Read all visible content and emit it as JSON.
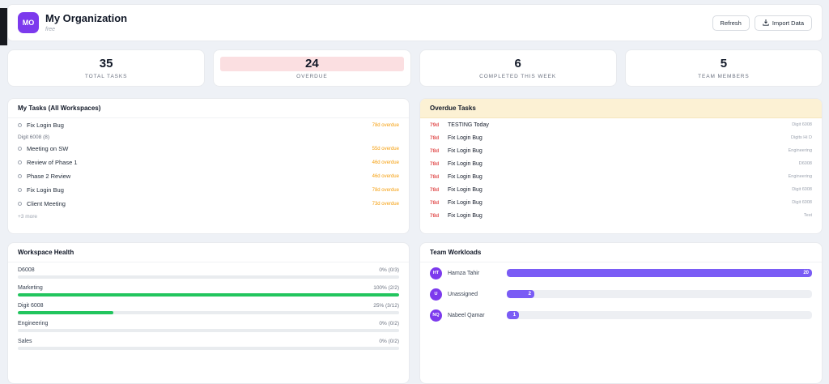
{
  "colors": {
    "accent": "#7c3aed",
    "workload_bar": "#7a5cf5",
    "overdue_stat_bg": "#fbdfe1",
    "overdue_days_text": "#e25555",
    "task_overdue_text": "#f59e0b",
    "health_bar": "#22c55e",
    "overdue_header_bg": "#fcf1d4"
  },
  "header": {
    "avatar_initials": "MO",
    "title": "My Organization",
    "subtitle": "free",
    "refresh_button": "Refresh",
    "import_button": "Import Data"
  },
  "stats": [
    {
      "value": "35",
      "label": "TOTAL TASKS",
      "highlight": false
    },
    {
      "value": "24",
      "label": "OVERDUE",
      "highlight": true
    },
    {
      "value": "6",
      "label": "COMPLETED THIS WEEK",
      "highlight": false
    },
    {
      "value": "5",
      "label": "TEAM MEMBERS",
      "highlight": false
    }
  ],
  "my_tasks": {
    "title": "My Tasks (All Workspaces)",
    "items": [
      {
        "type": "task",
        "name": "Fix Login Bug",
        "overdue": "78d overdue"
      },
      {
        "type": "group",
        "name": "Digit 6008 (8)"
      },
      {
        "type": "task",
        "name": "Meeting on SW",
        "overdue": "55d overdue"
      },
      {
        "type": "task",
        "name": "Review of Phase 1",
        "overdue": "46d overdue"
      },
      {
        "type": "task",
        "name": "Phase 2 Review",
        "overdue": "46d overdue"
      },
      {
        "type": "task",
        "name": "Fix Login Bug",
        "overdue": "78d overdue"
      },
      {
        "type": "task",
        "name": "Client Meeting",
        "overdue": "73d overdue"
      }
    ],
    "more_label": "+3 more"
  },
  "overdue_tasks": {
    "title": "Overdue Tasks",
    "items": [
      {
        "days": "79d",
        "name": "TESTING Today",
        "workspace": "Digit 6008"
      },
      {
        "days": "78d",
        "name": "Fix Login Bug",
        "workspace": "Digits Hi D"
      },
      {
        "days": "78d",
        "name": "Fix Login Bug",
        "workspace": "Engineering"
      },
      {
        "days": "78d",
        "name": "Fix Login Bug",
        "workspace": "D6008"
      },
      {
        "days": "78d",
        "name": "Fix Login Bug",
        "workspace": "Engineering"
      },
      {
        "days": "78d",
        "name": "Fix Login Bug",
        "workspace": "Digit 6008"
      },
      {
        "days": "78d",
        "name": "Fix Login Bug",
        "workspace": "Digit 6008"
      },
      {
        "days": "78d",
        "name": "Fix Login Bug",
        "workspace": "Test"
      }
    ]
  },
  "workspace_health": {
    "title": "Workspace Health",
    "items": [
      {
        "name": "D6008",
        "stat": "0% (0/3)",
        "percent": 0
      },
      {
        "name": "Marketing",
        "stat": "100% (2/2)",
        "percent": 100
      },
      {
        "name": "Digit 6008",
        "stat": "25% (3/12)",
        "percent": 25
      },
      {
        "name": "Engineering",
        "stat": "0% (0/2)",
        "percent": 0
      },
      {
        "name": "Sales",
        "stat": "0% (0/2)",
        "percent": 0
      }
    ]
  },
  "team_workloads": {
    "title": "Team Workloads",
    "items": [
      {
        "initials": "HT",
        "name": "Hamza Tahir",
        "count": "20",
        "percent": 100
      },
      {
        "initials": "U",
        "name": "Unassigned",
        "count": "2",
        "percent": 9
      },
      {
        "initials": "NQ",
        "name": "Nabeel Qamar",
        "count": "1",
        "percent": 4
      }
    ]
  }
}
